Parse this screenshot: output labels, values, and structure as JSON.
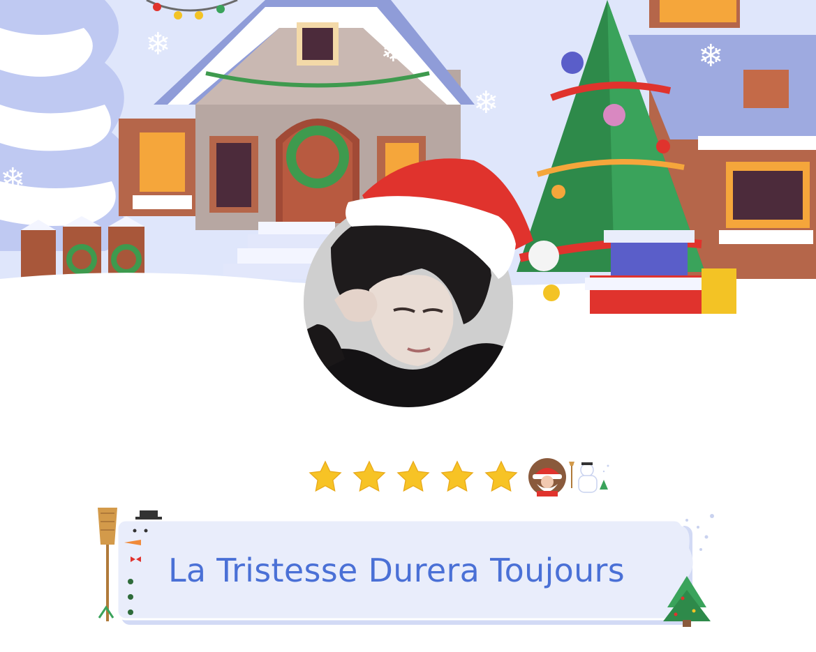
{
  "profile": {
    "display_name": "La Tristesse Durera Toujours",
    "rating_stars": 5,
    "rating_max": 5
  },
  "icons": {
    "banner": "christmas-village-illustration",
    "avatar": "profile-avatar-photo",
    "hat": "santa-hat-icon",
    "star": "star-icon",
    "badge_1": "santa-badge-icon",
    "badge_2": "snowman-badge-icon",
    "frame_left": "snowman-broom-icon",
    "frame_right": "christmas-tree-icon"
  },
  "colors": {
    "title_text": "#4a70d6",
    "title_bg": "#e9edfb",
    "star_fill": "#f7c325",
    "hat_red": "#e0332d",
    "sky": "#dfe6fb"
  }
}
